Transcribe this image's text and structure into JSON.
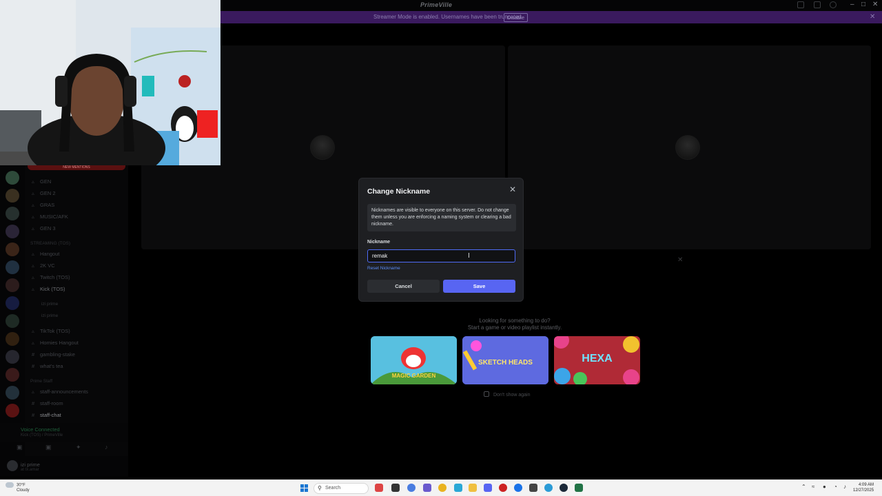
{
  "window": {
    "app_title": "PrimeVille"
  },
  "banner": {
    "message": "Streamer Mode is enabled. Usernames have been truncated.",
    "action_label": "Disable"
  },
  "channels": {
    "mention_bar": "NEW MENTIONS",
    "items": [
      {
        "label": "GEN"
      },
      {
        "label": "GEN 2"
      },
      {
        "label": "GRAS"
      },
      {
        "label": "MUSIC/AFK"
      },
      {
        "label": "GEN 3"
      }
    ],
    "category_streaming": "STREAMING (TOS)",
    "stream_items": [
      {
        "label": "Hangout"
      },
      {
        "label": "2K VC"
      },
      {
        "label": "Twitch (TOS)"
      },
      {
        "label": "Kick (TOS)"
      },
      {
        "label": "TikTok (TOS)"
      },
      {
        "label": "Homies Hangout"
      },
      {
        "label": "gambling-stake"
      },
      {
        "label": "what's tea"
      }
    ],
    "voice_users": [
      "izi prime",
      "izi prime"
    ],
    "category_staff": "Prime Staff",
    "staff_items": [
      {
        "label": "staff-announcements"
      },
      {
        "label": "staff-room"
      },
      {
        "label": "staff-chat"
      }
    ]
  },
  "voice_status": {
    "title": "Voice Connected",
    "detail": "Kick (TOS) / PrimeVille"
  },
  "user_panel": {
    "name": "izi prime",
    "status": "at tx.amar"
  },
  "activities": {
    "line1": "Looking for something to do?",
    "line2": "Start a game or video playlist instantly.",
    "cards": [
      {
        "name": "MAGIC GARDEN",
        "color": "#4fb6d8"
      },
      {
        "name": "SKETCH HEADS",
        "color": "#5b67d9"
      },
      {
        "name": "HEXA",
        "color": "#c8323e"
      }
    ],
    "dont_show_label": "Don't show again"
  },
  "modal": {
    "title": "Change Nickname",
    "warning": "Nicknames are visible to everyone on this server. Do not change them unless you are enforcing a naming system or clearing a bad nickname.",
    "field_label": "Nickname",
    "input_value": "remak",
    "reset_label": "Reset Nickname",
    "cancel_label": "Cancel",
    "save_label": "Save"
  },
  "taskbar": {
    "weather_temp": "30°F",
    "weather_desc": "Cloudy",
    "search_placeholder": "Search",
    "time": "4:09 AM",
    "date": "12/27/2025"
  },
  "colors": {
    "accent": "#5865f2",
    "input_focus": "#4f6cf7",
    "link": "#5b8cf7",
    "banner": "#3a1a5e"
  }
}
